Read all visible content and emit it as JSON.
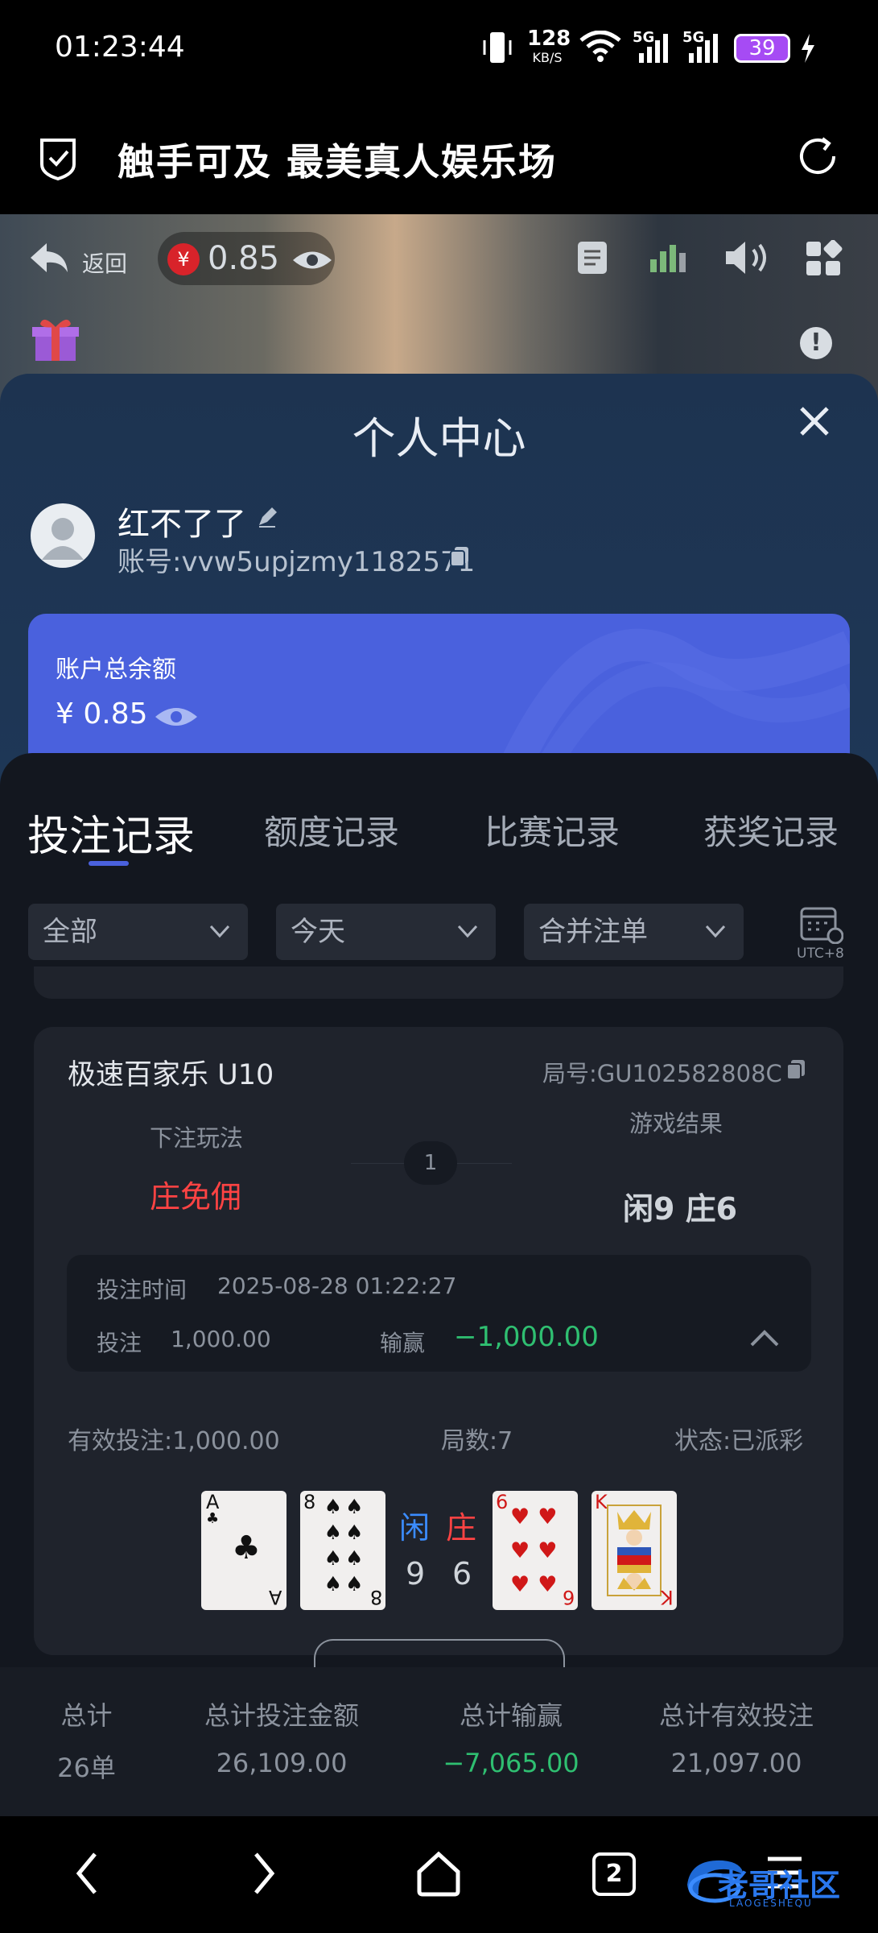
{
  "status_bar": {
    "time": "01:23:44",
    "net_speed": "128",
    "net_unit": "KB/S",
    "signal1": "5G",
    "signal2": "5G",
    "battery": "39"
  },
  "app_bar": {
    "title": "触手可及 最美真人娱乐场"
  },
  "video_overlay": {
    "back_label": "返回",
    "balance": "0.85",
    "currency_symbol": "¥"
  },
  "panel": {
    "title": "个人中心",
    "username": "红不了了",
    "account_label": "账号:",
    "account_id": "vvw5upjzmy1182571",
    "balance_card": {
      "label": "账户总余额",
      "amount": "¥ 0.85",
      "bg_color": "#4a61dd"
    }
  },
  "tabs": [
    {
      "label": "投注记录",
      "active": true
    },
    {
      "label": "额度记录",
      "active": false
    },
    {
      "label": "比赛记录",
      "active": false
    },
    {
      "label": "获奖记录",
      "active": false
    }
  ],
  "filters": {
    "type": "全部",
    "date": "今天",
    "merge": "合并注单",
    "timezone": "UTC+8"
  },
  "record": {
    "game": "极速百家乐 U10",
    "round_label": "局号:",
    "round_id": "GU102582808C",
    "bet_play_label": "下注玩法",
    "bet_play": "庄免佣",
    "step": "1",
    "result_label": "游戏结果",
    "result": "闲9 庄6",
    "bet_time_label": "投注时间",
    "bet_time": "2025-08-28 01:22:27",
    "stake_label": "投注",
    "stake": "1,000.00",
    "winloss_label": "输赢",
    "winloss": "−1,000.00",
    "valid_bet": "有效投注:1,000.00",
    "round_count": "局数:7",
    "status": "状态:已派彩",
    "player_label": "闲",
    "banker_label": "庄",
    "player_score": "9",
    "banker_score": "6",
    "player_cards": [
      {
        "rank": "A",
        "suit": "♣",
        "color": "#111111"
      },
      {
        "rank": "8",
        "suit": "♠",
        "color": "#111111"
      }
    ],
    "banker_cards": [
      {
        "rank": "6",
        "suit": "♥",
        "color": "#d01818"
      },
      {
        "rank": "K",
        "suit": "♦",
        "color": "#d01818"
      }
    ]
  },
  "summary": {
    "headers": [
      "总计",
      "总计投注金额",
      "总计输赢",
      "总计有效投注"
    ],
    "values": [
      "26单",
      "26,109.00",
      "−7,065.00",
      "21,097.00"
    ]
  },
  "nav": {
    "tab_count": "2",
    "watermark": "老哥社区",
    "watermark_sub": "LAOGESHEQU"
  }
}
